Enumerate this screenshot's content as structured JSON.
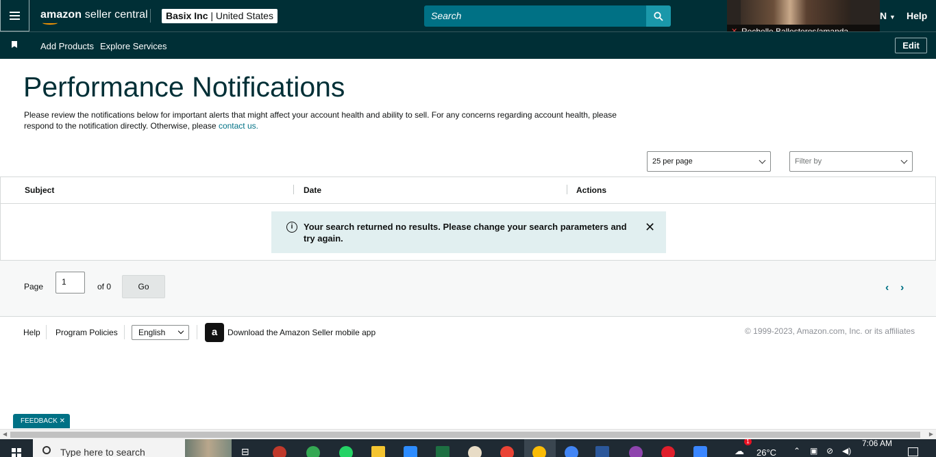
{
  "header": {
    "logo_main": "amazon",
    "logo_sub": "seller central",
    "account_bold": "Basix Inc",
    "account_sep": " | ",
    "account_region": "United States",
    "search_placeholder": "Search",
    "lang": "N",
    "help": "Help"
  },
  "video_overlay": {
    "participant": "Rechelle Ballesteros/amanda"
  },
  "subnav": {
    "items": [
      {
        "label": "Add Products"
      },
      {
        "label": "Explore Services"
      }
    ],
    "edit": "Edit"
  },
  "main": {
    "title": "Performance Notifications",
    "description": "Please review the notifications below for important alerts that might affect your account health and ability to sell. For any concerns regarding account health, please respond to the notification directly. Otherwise, please ",
    "contact_link": "contact us.",
    "per_page": "25 per page",
    "filter_placeholder": "Filter by"
  },
  "table": {
    "columns": [
      "Subject",
      "Date",
      "Actions"
    ],
    "empty_message": "Your search returned no results. Please change your search parameters and try again."
  },
  "pager": {
    "page_label": "Page",
    "page_value": "1",
    "of_label": "of 0",
    "go": "Go"
  },
  "footer": {
    "help": "Help",
    "policies": "Program Policies",
    "language": "English",
    "app_icon_letter": "a",
    "download": "Download the Amazon Seller mobile app",
    "copyright": "© 1999-2023, Amazon.com, Inc. or its affiliates"
  },
  "feedback": "FEEDBACK ✕",
  "taskbar": {
    "search_text": "Type here to search",
    "temperature": "26°C",
    "time": "7:06 AM",
    "notification_count": "1"
  },
  "colors": {
    "header_bg": "#002f36",
    "accent": "#007185",
    "alert_bg": "#e1eff0"
  }
}
